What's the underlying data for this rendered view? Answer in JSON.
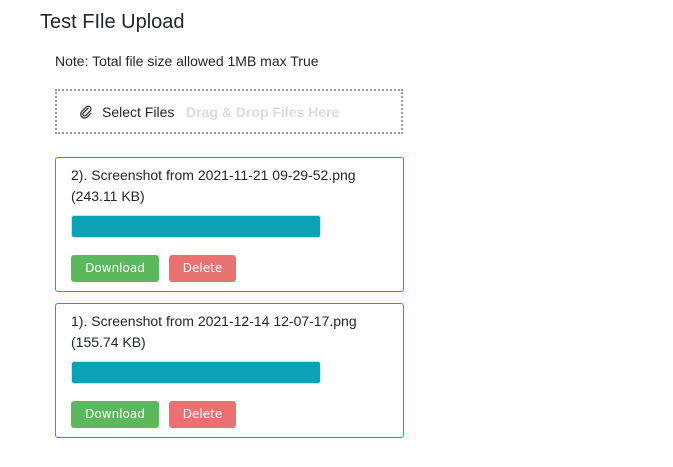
{
  "page": {
    "title": "Test FIle Upload",
    "note": "Note: Total file size allowed 1MB max True"
  },
  "dropzone": {
    "select_label": "Select Files",
    "hint": "Drag & Drop Files Here",
    "icon": "paperclip-icon"
  },
  "files": [
    {
      "name": "2). Screenshot from 2021-11-21 09-29-52.png",
      "size": "(243.11 KB)",
      "progress_percent": 100,
      "download_label": "Download",
      "delete_label": "Delete"
    },
    {
      "name": "1). Screenshot from 2021-12-14 12-07-17.png",
      "size": "(155.74 KB)",
      "progress_percent": 100,
      "download_label": "Download",
      "delete_label": "Delete"
    }
  ],
  "colors": {
    "card_border": "#17a2b8",
    "progress": "#0aa2b5",
    "download": "#5cb85c",
    "delete": "#e87272"
  }
}
